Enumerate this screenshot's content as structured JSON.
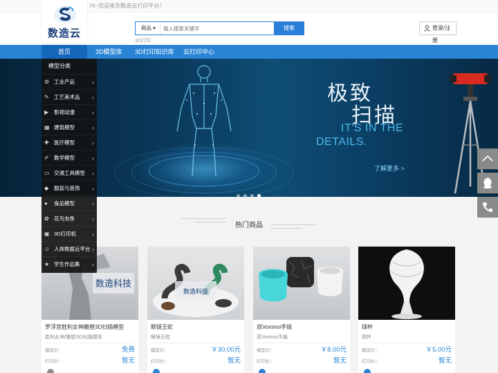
{
  "topbar": {
    "welcome": "Hi~欢迎来到数造云打印平台！"
  },
  "logo": {
    "text": "数造云"
  },
  "search": {
    "category": "商品",
    "placeholder": "输入搜索关键字",
    "button": "搜索",
    "hotword": "3D打印"
  },
  "login": {
    "label": "登录/注册",
    "icon": "user-icon"
  },
  "nav": {
    "items": [
      "首页",
      "3D模型库",
      "3D打印知识库",
      "云打印中心"
    ],
    "active": 0,
    "color": "#2a84d6"
  },
  "categories": {
    "title": "模型分类",
    "items": [
      {
        "label": "工业产品",
        "icon": "industry-icon"
      },
      {
        "label": "工艺美术品",
        "icon": "art-icon"
      },
      {
        "label": "影视动漫",
        "icon": "film-icon"
      },
      {
        "label": "建筑模型",
        "icon": "building-icon"
      },
      {
        "label": "医疗模型",
        "icon": "medical-icon"
      },
      {
        "label": "教学模型",
        "icon": "teaching-icon"
      },
      {
        "label": "交通工具模型",
        "icon": "vehicle-icon"
      },
      {
        "label": "服装与首饰",
        "icon": "diamond-icon"
      },
      {
        "label": "食品模型",
        "icon": "food-icon"
      },
      {
        "label": "花鸟虫鱼",
        "icon": "flower-icon"
      },
      {
        "label": "3D打印机",
        "icon": "printer-icon"
      },
      {
        "label": "人体数据云平台",
        "icon": "body-icon"
      },
      {
        "label": "学生作品集",
        "icon": "student-icon"
      }
    ]
  },
  "banner": {
    "line1": "极致",
    "line2": "扫描",
    "line3": "IT'S IN THE",
    "line4": "DETAILS.",
    "more": "了解更多 >",
    "slides": 4,
    "active_slide": 3
  },
  "floating": [
    {
      "name": "back-to-top",
      "icon": "arrow-up-icon"
    },
    {
      "name": "qq-service",
      "icon": "qq-icon"
    },
    {
      "name": "phone-service",
      "icon": "phone-icon"
    }
  ],
  "hot": {
    "title": "热门商品",
    "model_price_label": "模型价：",
    "print_price_label": "打印价：",
    "products": [
      {
        "name": "罗浮宫胜利女神雕塑3D扫描模型",
        "sub": "胜利女神/雕塑/3D扫描模型",
        "model_price": "免费",
        "print_price": "暂无"
      },
      {
        "name": "眼镜王蛇",
        "sub": "眼镜王蛇",
        "model_price": "￥30.00元",
        "print_price": "暂无",
        "watermark": "数造科技"
      },
      {
        "name": "双Voronoi手链",
        "sub": "双Voronoi手链",
        "model_price": "￥8.00元",
        "print_price": "暂无"
      },
      {
        "name": "球杯",
        "sub": "球杯",
        "model_price": "￥5.00元",
        "print_price": "暂无"
      }
    ]
  }
}
